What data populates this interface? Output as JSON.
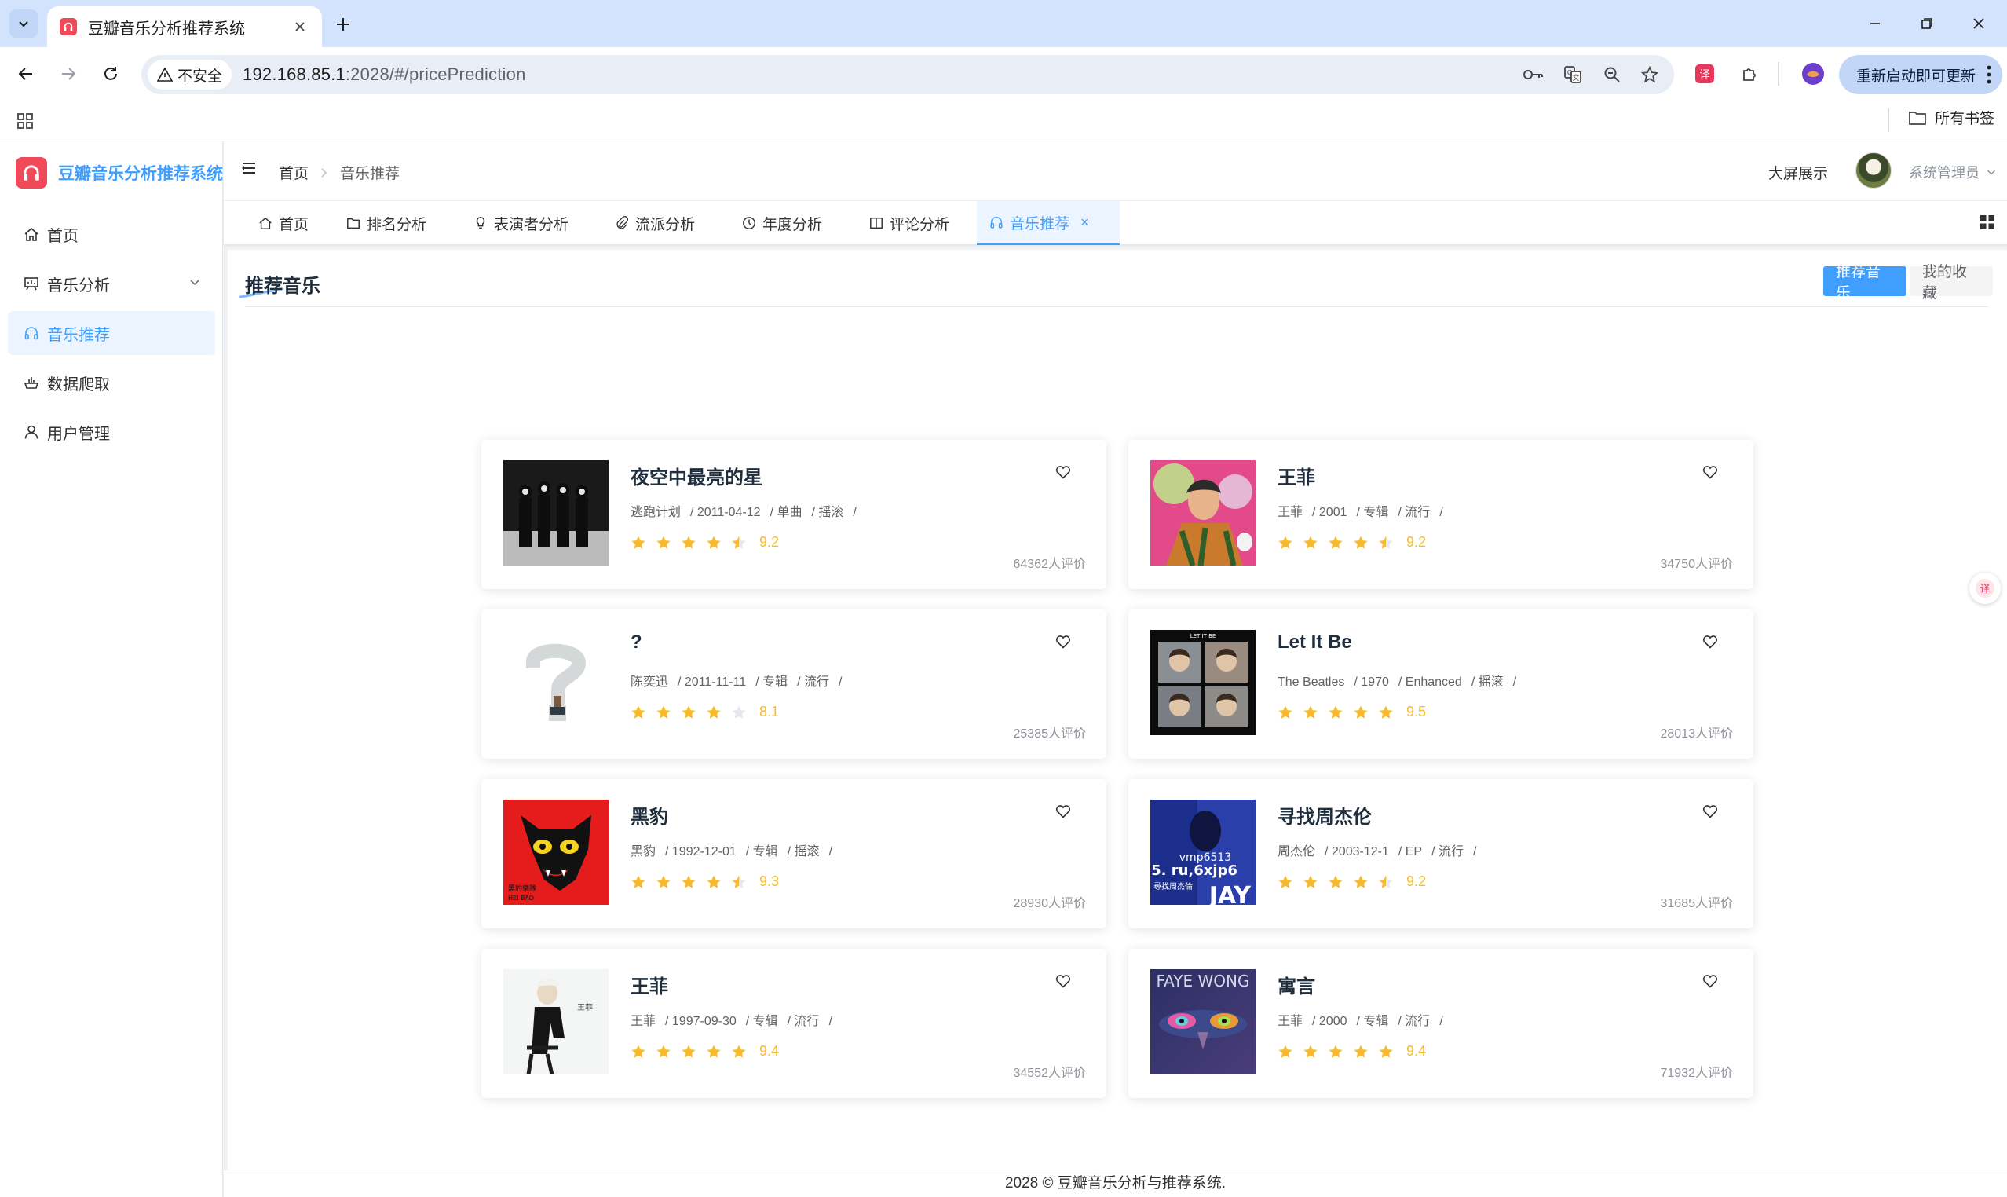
{
  "browser": {
    "tab_title": "豆瓣音乐分析推荐系统",
    "security_label": "不安全",
    "url_host": "192.168.85.1",
    "url_path": ":2028/#/pricePrediction",
    "update_button": "重新启动即可更新",
    "bookmarks_all": "所有书签"
  },
  "app": {
    "logo_text": "豆瓣音乐分析推荐系统",
    "sidebar": {
      "items": [
        {
          "label": "首页",
          "icon": "home-icon"
        },
        {
          "label": "音乐分析",
          "icon": "chart-board-icon"
        },
        {
          "label": "音乐推荐",
          "icon": "headphones-icon"
        },
        {
          "label": "数据爬取",
          "icon": "crawler-icon"
        },
        {
          "label": "用户管理",
          "icon": "user-icon"
        }
      ]
    },
    "breadcrumb": {
      "home": "首页",
      "current": "音乐推荐"
    },
    "header_right": {
      "big_screen": "大屏展示",
      "username": "系统管理员"
    },
    "tags": [
      {
        "label": "首页",
        "icon": "home-icon"
      },
      {
        "label": "排名分析",
        "icon": "folder-icon"
      },
      {
        "label": "表演者分析",
        "icon": "bulb-icon"
      },
      {
        "label": "流派分析",
        "icon": "paperclip-icon"
      },
      {
        "label": "年度分析",
        "icon": "clock-icon"
      },
      {
        "label": "评论分析",
        "icon": "book-icon"
      },
      {
        "label": "音乐推荐",
        "icon": "headphones-icon",
        "close": "×"
      }
    ],
    "page_title": "推荐音乐",
    "segments": {
      "recommend": "推荐音乐",
      "favorites": "我的收藏"
    },
    "cards": [
      {
        "title": "夜空中最亮的星",
        "artist": "逃跑计划",
        "date": "2011-04-12",
        "format": "单曲",
        "genre": "摇滚",
        "stars": 4.5,
        "score": "9.2",
        "count": "64362人评价"
      },
      {
        "title": "王菲",
        "artist": "王菲",
        "date": "2001",
        "format": "专辑",
        "genre": "流行",
        "stars": 4.5,
        "score": "9.2",
        "count": "34750人评价"
      },
      {
        "title": "?",
        "artist": "陈奕迅",
        "date": "2011-11-11",
        "format": "专辑",
        "genre": "流行",
        "stars": 4,
        "score": "8.1",
        "count": "25385人评价"
      },
      {
        "title": "Let It Be",
        "artist": "The Beatles",
        "date": "1970",
        "format": "Enhanced",
        "genre": "摇滚",
        "stars": 5,
        "score": "9.5",
        "count": "28013人评价"
      },
      {
        "title": "黑豹",
        "artist": "黑豹",
        "date": "1992-12-01",
        "format": "专辑",
        "genre": "摇滚",
        "stars": 4.5,
        "score": "9.3",
        "count": "28930人评价"
      },
      {
        "title": "寻找周杰伦",
        "artist": "周杰伦",
        "date": "2003-12-1",
        "format": "EP",
        "genre": "流行",
        "stars": 4.5,
        "score": "9.2",
        "count": "31685人评价"
      },
      {
        "title": "王菲",
        "artist": "王菲",
        "date": "1997-09-30",
        "format": "专辑",
        "genre": "流行",
        "stars": 5,
        "score": "9.4",
        "count": "34552人评价"
      },
      {
        "title": "寓言",
        "artist": "王菲",
        "date": "2000",
        "format": "专辑",
        "genre": "流行",
        "stars": 5,
        "score": "9.4",
        "count": "71932人评价"
      }
    ],
    "cover_texts": {
      "letitbe": "LET IT BE",
      "heibao_cn": "黑豹樂隊",
      "heibao_en": "HEI BAO",
      "jay_line1": "vmp6513",
      "jay_line2": "5. ru,6xjp6",
      "jay_line3": "JAY",
      "jay_cn": "尋找周杰倫",
      "faye_en": "FAYE WONG",
      "faye_cn": "王菲"
    },
    "footer": "2028 © 豆瓣音乐分析与推荐系统.",
    "colors": {
      "accent": "#409eff",
      "star": "#f7ba2a",
      "logo": "#f04a5a"
    }
  }
}
